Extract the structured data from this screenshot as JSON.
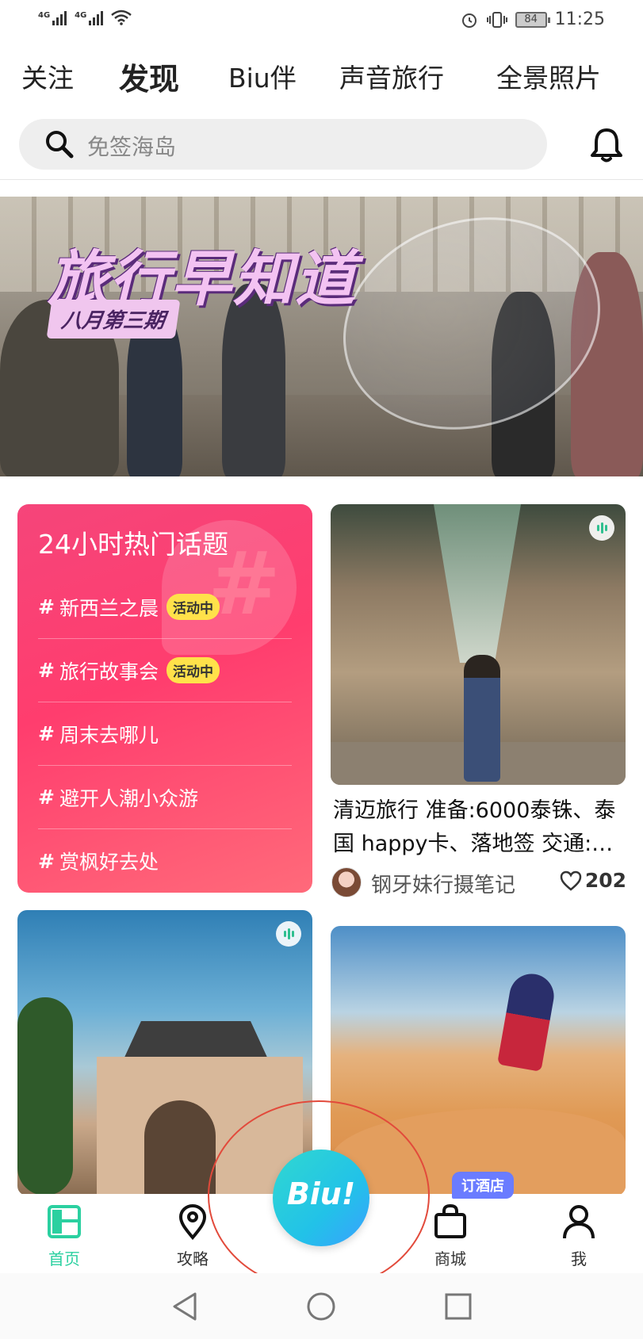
{
  "status_bar": {
    "network1": "4G",
    "network2": "4G",
    "battery": "84",
    "time": "11:25"
  },
  "tabs": [
    {
      "label": "关注"
    },
    {
      "label": "发现",
      "active": true
    },
    {
      "label": "Biu伴"
    },
    {
      "label": "声音旅行"
    },
    {
      "label": "全景照片"
    }
  ],
  "search": {
    "placeholder": "免签海岛"
  },
  "banner": {
    "title": "旅行早知道",
    "subtitle": "八月第三期"
  },
  "hot_topics": {
    "title": "24小时热门话题",
    "items": [
      {
        "label": "新西兰之晨",
        "badge": "活动中"
      },
      {
        "label": "旅行故事会",
        "badge": "活动中"
      },
      {
        "label": "周末去哪儿"
      },
      {
        "label": "避开人潮小众游"
      },
      {
        "label": "赏枫好去处"
      }
    ]
  },
  "feed": {
    "card_a": {
      "text": "清迈旅行 准备:6000泰铢、泰国 happy卡、落地签 交通:…",
      "author": "钢牙妹行摄笔记",
      "likes": "202"
    }
  },
  "bottom_nav": {
    "items": [
      {
        "label": "首页",
        "active": true
      },
      {
        "label": "攻略"
      },
      {
        "label": "商城"
      },
      {
        "label": "我"
      }
    ],
    "center_button": "Biu!",
    "hotel_tag": "订酒店"
  },
  "colors": {
    "accent": "#2bd0a0",
    "hot_card": "#ff3d6e",
    "badge": "#ffe14a",
    "hotel_tag": "#6a7cff"
  },
  "icons": [
    "signal-icon",
    "wifi-icon",
    "alarm-icon",
    "vibrate-icon",
    "battery-icon",
    "search-icon",
    "bell-icon",
    "audio-icon",
    "heart-icon",
    "home-icon",
    "location-pin-icon",
    "shopping-bag-icon",
    "person-icon",
    "back-icon",
    "home-circle-icon",
    "recents-icon"
  ]
}
